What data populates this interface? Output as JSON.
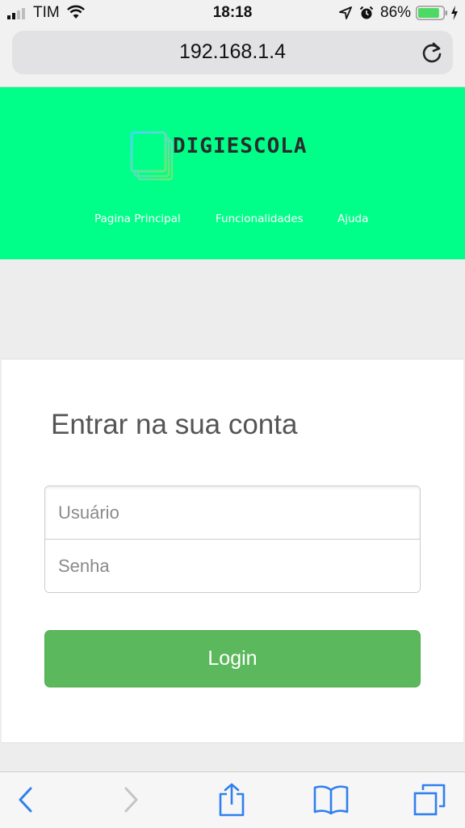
{
  "status_bar": {
    "carrier": "TIM",
    "time": "18:18",
    "battery_percent": "86%",
    "battery_level": 0.86
  },
  "browser": {
    "url": "192.168.1.4"
  },
  "site": {
    "brand": "DIGIESCOLA",
    "nav": [
      {
        "label": "Pagina Principal"
      },
      {
        "label": "Funcionalidades"
      },
      {
        "label": "Ajuda"
      }
    ]
  },
  "login": {
    "title": "Entrar na sua conta",
    "username_placeholder": "Usuário",
    "password_placeholder": "Senha",
    "submit_label": "Login"
  },
  "colors": {
    "header_bg": "#00ff88",
    "button_bg": "#5cb85c",
    "ios_blue": "#2f80ed"
  }
}
